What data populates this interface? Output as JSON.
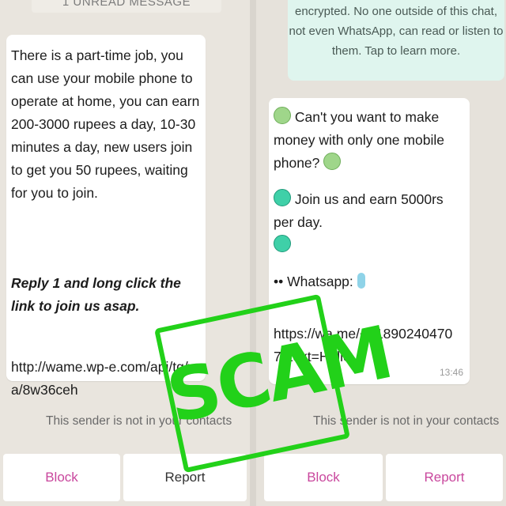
{
  "left": {
    "unread_label": "1 UNREAD MESSAGE",
    "message": {
      "body": "There is a part-time job, you can use your mobile phone to operate at home, you can earn 200-3000 rupees a day, 10-30 minutes a day, new users join to get you 50 rupees, waiting for you to join.",
      "instruction": "Reply 1 and long click the link to join us asap.",
      "link": "http://wame.wp-e.com/api/tg/wa/8w36ceh"
    },
    "sender_note": "This sender is not in your contacts",
    "block_label": "Block",
    "report_label": "Report"
  },
  "right": {
    "encryption_note": "encrypted. No one outside of this chat, not even WhatsApp, can read or listen to them. Tap to learn more.",
    "message": {
      "line1": "Can't you want to make money with only one mobile phone?",
      "line2": "Join us and earn 5000rs per day.",
      "line3": "•• Whatsapp:",
      "line4": "https://wa.me/+918902404707?text=Hello",
      "time": "13:46"
    },
    "sender_note": "This sender is not in your contacts",
    "block_label": "Block",
    "report_label": "Report"
  },
  "overlay": {
    "stamp_text": "SCAM",
    "stamp_color": "#22d119"
  },
  "colors": {
    "action": "#c9479d",
    "encryption_bg": "#dff5ee"
  }
}
